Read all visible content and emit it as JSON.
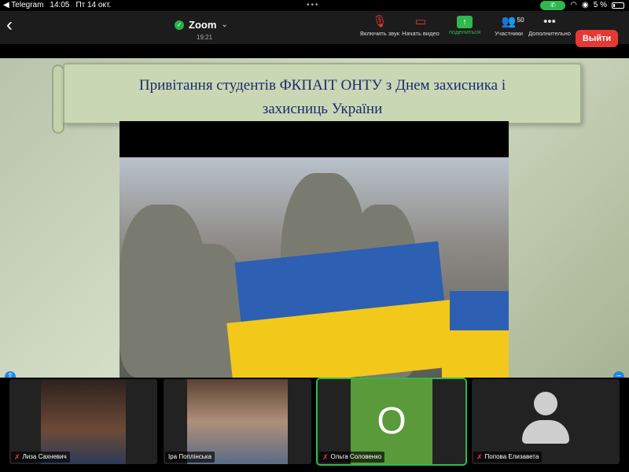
{
  "status_bar": {
    "back_app": "◀ Telegram",
    "time": "14:05",
    "date": "Пт 14 окт.",
    "battery": "5 %"
  },
  "toolbar": {
    "app_title": "Zoom",
    "meeting_time": "19:21",
    "mic_label": "Включить звук",
    "video_label": "Начать видео",
    "share_label": "поделиться",
    "participants_label": "Участники",
    "participants_count": "50",
    "more_label": "Дополнительно",
    "leave_label": "Выйти"
  },
  "shared_screen": {
    "banner_line1": "Привітання студентів ФКПАІТ ОНТУ  з Днем захисника і",
    "banner_line2": "захисниць України"
  },
  "participants": [
    {
      "name": "Лиза Сахневич",
      "muted": true,
      "type": "video"
    },
    {
      "name": "Іра Поплінська",
      "muted": false,
      "type": "video"
    },
    {
      "name": "Ольга Соловенко",
      "muted": true,
      "type": "initial",
      "initial": "O",
      "active": true
    },
    {
      "name": "Попова Елизавета",
      "muted": true,
      "type": "avatar"
    }
  ],
  "colors": {
    "leave": "#e53935",
    "share": "#2fb84d",
    "active_speaker": "#2fb84d",
    "banner_text": "#1e2a6a"
  },
  "icons": {
    "back": "chevron-left-icon",
    "mic": "mic-off-icon",
    "video": "video-off-icon",
    "share": "share-screen-icon",
    "participants": "people-icon",
    "more": "more-dots-icon"
  }
}
